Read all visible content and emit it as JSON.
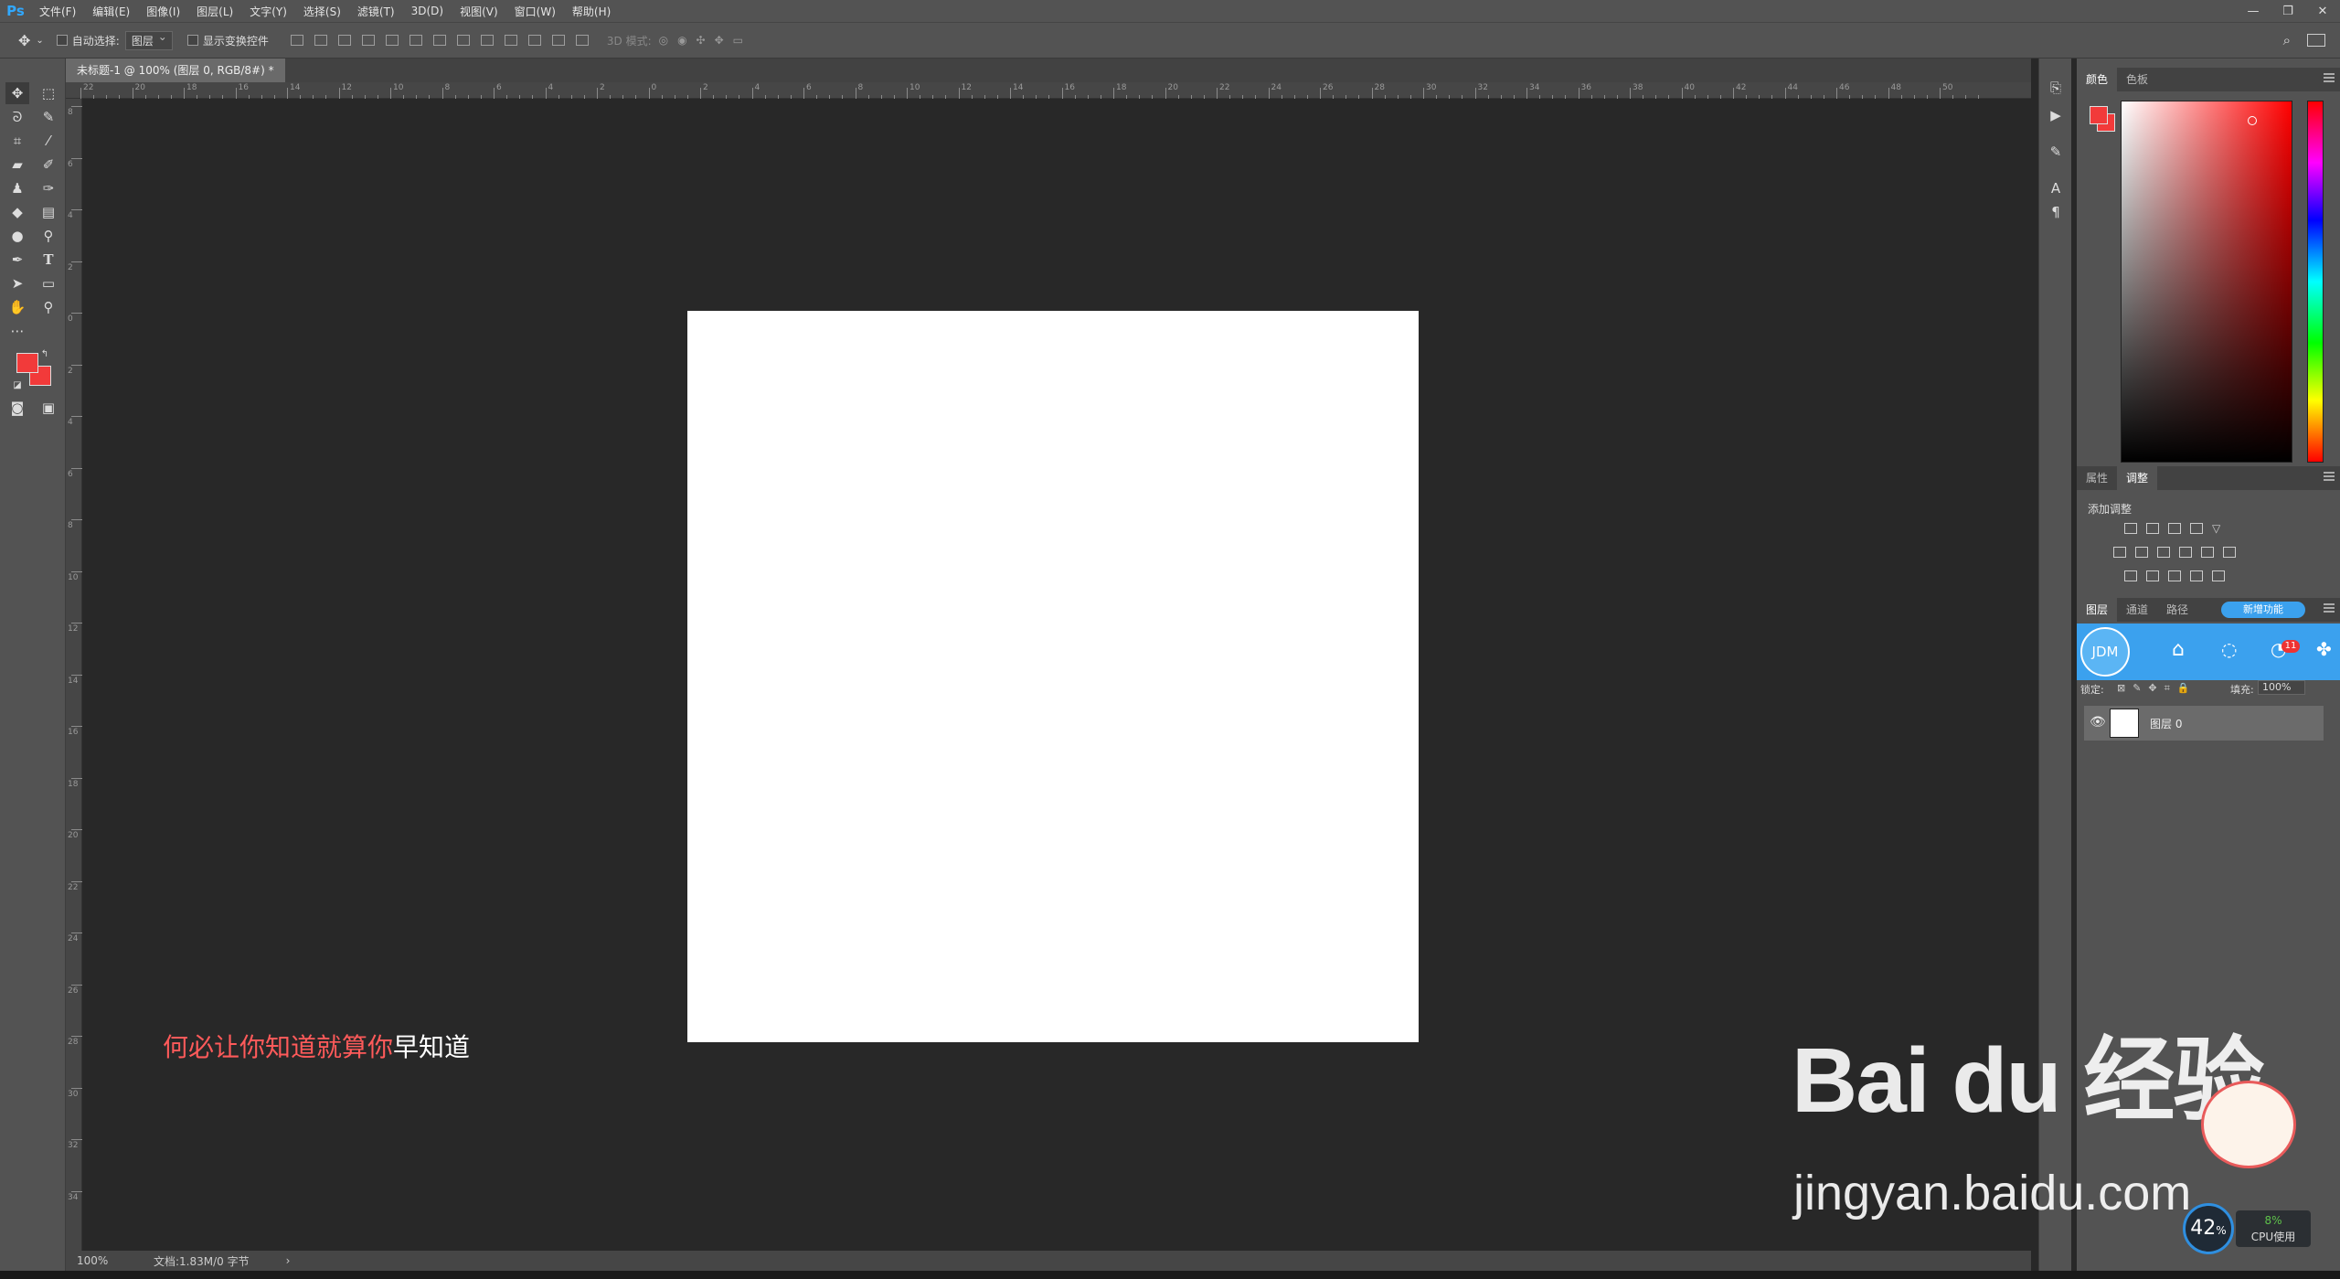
{
  "app": {
    "logo": "Ps"
  },
  "menu": [
    "文件(F)",
    "编辑(E)",
    "图像(I)",
    "图层(L)",
    "文字(Y)",
    "选择(S)",
    "滤镜(T)",
    "3D(D)",
    "视图(V)",
    "窗口(W)",
    "帮助(H)"
  ],
  "window_controls": [
    "—",
    "❐",
    "✕"
  ],
  "options": {
    "auto_select_label": "自动选择:",
    "auto_select_value": "图层",
    "show_transform_label": "显示变换控件",
    "mode3d_label": "3D 模式:"
  },
  "document_tab": {
    "title": "未标题-1 @ 100% (图层 0, RGB/8#) *",
    "close": "×"
  },
  "ruler_h": [
    "22",
    "20",
    "18",
    "16",
    "14",
    "12",
    "10",
    "8",
    "6",
    "4",
    "2",
    "0",
    "2",
    "4",
    "6",
    "8",
    "10",
    "12",
    "14",
    "16",
    "18",
    "20",
    "22",
    "24",
    "26",
    "28",
    "30",
    "32",
    "34",
    "36",
    "38",
    "40",
    "42",
    "44",
    "46",
    "48",
    "50"
  ],
  "ruler_v": [
    "8",
    "6",
    "4",
    "2",
    "0",
    "2",
    "4",
    "6",
    "8",
    "10",
    "12",
    "14",
    "16",
    "18",
    "20",
    "22",
    "24",
    "26",
    "28",
    "30",
    "32",
    "34"
  ],
  "status": {
    "zoom": "100%",
    "doc": "文档:1.83M/0 字节",
    "arrow": "›"
  },
  "panels": {
    "color_tabs": [
      "颜色",
      "色板"
    ],
    "adjust_tabs": [
      "属性",
      "调整"
    ],
    "adjust_add": "添加调整",
    "layer_tabs": [
      "图层",
      "通道",
      "路径"
    ],
    "lock_label": "锁定:",
    "fill_label": "填充:",
    "fill_value": "100%",
    "layer_name": "图层 0"
  },
  "jdm": {
    "avatar": "JDM",
    "badge": "11",
    "button": "新增功能"
  },
  "cpu": {
    "percent": "42",
    "unit": "%",
    "usage": "8%",
    "label": "CPU使用"
  },
  "lyrics": {
    "highlighted": "何必让你知道就算你",
    "rest": "早知道"
  },
  "watermark": {
    "brand": "Bai du 经验",
    "url": "jingyan.baidu.com"
  },
  "colors": {
    "foreground": "#f23a3a",
    "background": "#f23a3a",
    "accent": "#31a8ff",
    "lyric_highlight": "#ff5a5a"
  }
}
